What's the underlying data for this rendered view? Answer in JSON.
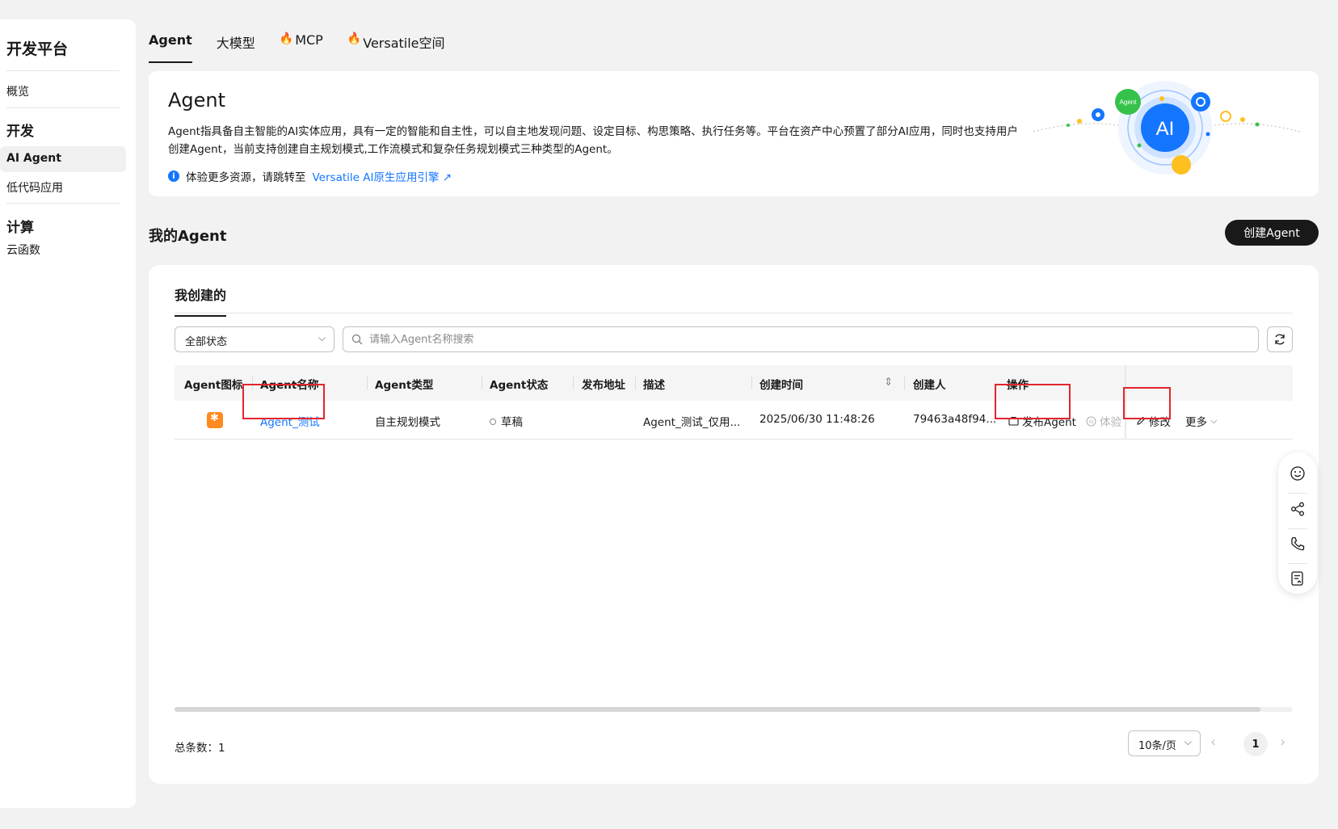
{
  "sidebar": {
    "title": "开发平台",
    "items": [
      {
        "label": "概览"
      },
      {
        "label": "开发"
      },
      {
        "label": "AI Agent"
      },
      {
        "label": "低代码应用"
      },
      {
        "label": "计算"
      },
      {
        "label": "云函数"
      }
    ]
  },
  "tabs": [
    {
      "label": "Agent",
      "active": true
    },
    {
      "label": "大模型"
    },
    {
      "label": "MCP"
    },
    {
      "label": "Versatile空间"
    }
  ],
  "banner": {
    "title": "Agent",
    "description": "Agent指具备自主智能的AI实体应用，具有一定的智能和自主性，可以自主地发现问题、设定目标、构思策略、执行任务等。平台在资产中心预置了部分AI应用，同时也支持用户创建Agent，当前支持创建自主规划模式,工作流模式和复杂任务规划模式三种类型的Agent。",
    "info_text": "体验更多资源，请跳转至",
    "link_text": "Versatile AI原生应用引擎",
    "illustration": {
      "badge_agent": "Agent",
      "badge_ai": "AI"
    }
  },
  "my_agent": {
    "title": "我的Agent",
    "create_button": "创建Agent"
  },
  "card": {
    "sub_tab": "我创建的",
    "status_select": "全部状态",
    "search_placeholder": "请输入Agent名称搜索",
    "columns": [
      "Agent图标",
      "Agent名称",
      "Agent类型",
      "Agent状态",
      "发布地址",
      "描述",
      "创建时间",
      "创建人",
      "操作"
    ],
    "rows": [
      {
        "name": "Agent_测试",
        "type": "自主规划模式",
        "status": "草稿",
        "address": "",
        "description": "Agent_测试_仅用...",
        "created": "2025/06/30 11:48:26",
        "creator": "79463a48f94...",
        "actions": {
          "publish": "发布Agent",
          "try": "体验",
          "edit": "修改",
          "more": "更多"
        }
      }
    ],
    "total": "总条数：1",
    "page_size": "10条/页",
    "current_page": "1"
  },
  "colors": {
    "accent": "#1476ff",
    "highlight": "#e3252b",
    "fire": "#ff6a00"
  }
}
